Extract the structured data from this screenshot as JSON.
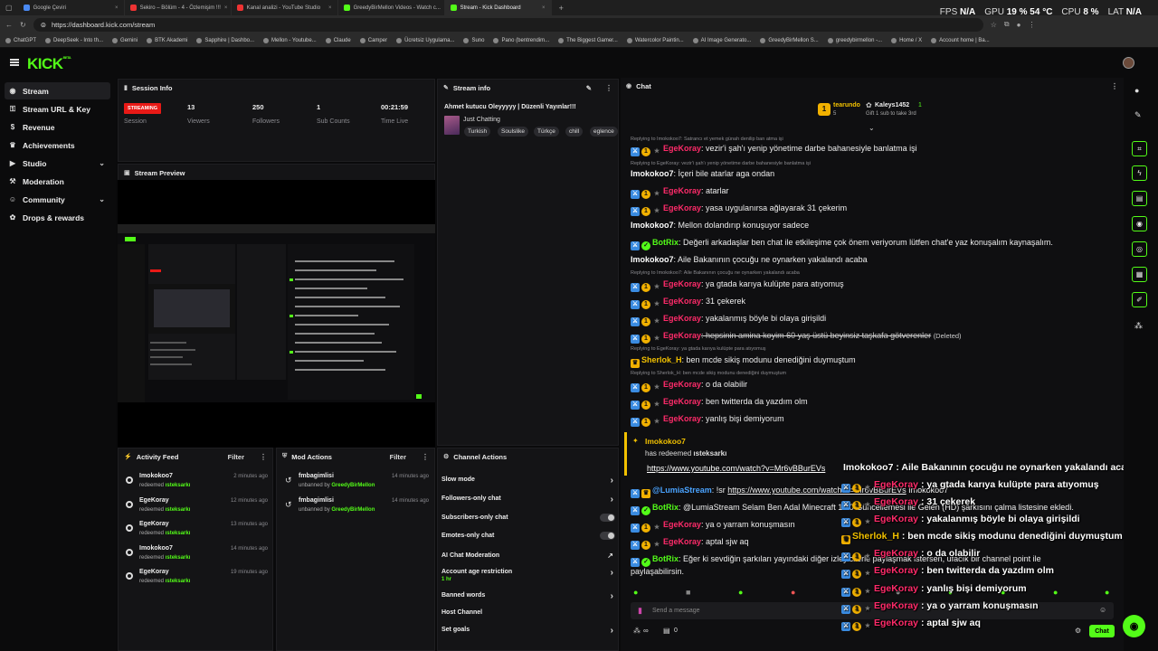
{
  "browser": {
    "tabs": [
      {
        "title": "Google Çeviri",
        "color": "#4a8af4"
      },
      {
        "title": "Sekiro – Bölüm - 4 - Özlemişim !!!",
        "color": "#e33"
      },
      {
        "title": "Kanal analizi - YouTube Studio",
        "color": "#e33"
      },
      {
        "title": "GreedyBirMellon Videos - Watch c...",
        "color": "#53fc18"
      },
      {
        "title": "Stream - Kick Dashboard",
        "color": "#53fc18"
      }
    ],
    "url": "https://dashboard.kick.com/stream",
    "stats": {
      "fps_label": "FPS",
      "fps": "N/A",
      "gpu_label": "GPU",
      "gpu": "19 % 54 °C",
      "cpu_label": "CPU",
      "cpu": "8 %",
      "lat_label": "LAT",
      "lat": "N/A"
    },
    "bookmarks": [
      "ChatGPT",
      "DeepSeek - Into th...",
      "Gemini",
      "BTK Akademi",
      "Sapphire | Dashbo...",
      "Mellon - Youtube...",
      "Claude",
      "Camper",
      "Ücretsiz Uygulama...",
      "Suno",
      "Pano (bentrendim...",
      "The Biggest Gamer...",
      "Watercolor Paintin...",
      "AI Image Generato...",
      "GreedyBirMellon S...",
      "greedybirmellon -...",
      "Home / X",
      "Account home | Ba..."
    ]
  },
  "brand": {
    "logo": "KICK",
    "logo_sup": "BETA",
    "accent": "#53fc18"
  },
  "sidebar": {
    "items": [
      {
        "label": "Stream",
        "icon": "radio-icon"
      },
      {
        "label": "Stream URL & Key",
        "icon": "key-icon"
      },
      {
        "label": "Revenue",
        "icon": "dollar-icon"
      },
      {
        "label": "Achievements",
        "icon": "trophy-icon"
      },
      {
        "label": "Studio",
        "icon": "video-icon"
      },
      {
        "label": "Moderation",
        "icon": "hammer-icon"
      },
      {
        "label": "Community",
        "icon": "people-icon"
      },
      {
        "label": "Drops & rewards",
        "icon": "gift-icon"
      }
    ]
  },
  "session": {
    "title": "Session Info",
    "status": "STREAMING",
    "status_label": "Session",
    "viewers": "13",
    "viewers_label": "Viewers",
    "followers": "250",
    "followers_label": "Followers",
    "subs": "1",
    "subs_label": "Sub Counts",
    "time": "00:21:59",
    "time_label": "Time Live"
  },
  "stream_info": {
    "title": "Stream info",
    "stream_title": "Ahmet kutucu Oleyyyyy | Düzenli Yayınlar!!!",
    "category": "Just Chatting",
    "tags": [
      "Turkish",
      "Soulslike",
      "Türkçe",
      "chill",
      "eglence"
    ]
  },
  "preview": {
    "title": "Stream Preview"
  },
  "activity": {
    "title": "Activity Feed",
    "filter": "Filter",
    "items": [
      {
        "user": "Imokokoo7",
        "action": "redeemed",
        "reward": "ısteksarkı",
        "time": "2 minutes ago"
      },
      {
        "user": "EgeKoray",
        "action": "redeemed",
        "reward": "ısteksarkı",
        "time": "12 minutes ago"
      },
      {
        "user": "EgeKoray",
        "action": "redeemed",
        "reward": "ısteksarkı",
        "time": "13 minutes ago"
      },
      {
        "user": "Imokokoo7",
        "action": "redeemed",
        "reward": "ısteksarkı",
        "time": "14 minutes ago"
      },
      {
        "user": "EgeKoray",
        "action": "redeemed",
        "reward": "ısteksarkı",
        "time": "19 minutes ago"
      }
    ]
  },
  "mod_actions": {
    "title": "Mod Actions",
    "filter": "Filter",
    "items": [
      {
        "user": "fmbagimlisi",
        "action": "unbanned by",
        "by": "GreedyBirMellon",
        "time": "14 minutes ago"
      },
      {
        "user": "fmbagimlisi",
        "action": "unbanned by",
        "by": "GreedyBirMellon",
        "time": "14 minutes ago"
      }
    ]
  },
  "channel_actions": {
    "title": "Channel Actions",
    "items": [
      {
        "label": "Slow mode",
        "kind": "chevron"
      },
      {
        "label": "Followers-only chat",
        "kind": "chevron"
      },
      {
        "label": "Subscribers-only chat",
        "kind": "toggle"
      },
      {
        "label": "Emotes-only chat",
        "kind": "toggle"
      },
      {
        "label": "AI Chat Moderation",
        "kind": "external"
      },
      {
        "label": "Account age restriction",
        "kind": "chevron",
        "sub": "1 hr"
      },
      {
        "label": "Banned words",
        "kind": "chevron"
      },
      {
        "label": "Host Channel",
        "kind": "none"
      },
      {
        "label": "Set goals",
        "kind": "chevron"
      }
    ]
  },
  "chat": {
    "title": "Chat",
    "pinned": {
      "user1": "tearundo",
      "count1": "5",
      "user2": "Kaleys1452",
      "count2": "1",
      "gift": "Gift 1 sub to take 3rd"
    },
    "messages": [
      {
        "reply": "Replying to Imokokoo7: Satrancı et yemek günah denilip ban atma işi"
      },
      {
        "badges": [
          "blue",
          "gold",
          "grey"
        ],
        "user": "EgeKoray",
        "ucolor": "red",
        "text": ": vezir'i şah'ı yenip yönetime darbe bahanesiyle banlatma işi"
      },
      {
        "reply": "Replying to EgeKoray: vezir'i şah'ı yenip yönetime darbe bahanesiyle banlatma işi"
      },
      {
        "badges": [],
        "user": "Imokokoo7",
        "ucolor": "white",
        "text": ": İçeri bile atarlar aga ondan"
      },
      {
        "badges": [
          "blue",
          "gold",
          "grey"
        ],
        "user": "EgeKoray",
        "ucolor": "red",
        "text": ": atarlar"
      },
      {
        "badges": [
          "blue",
          "gold",
          "grey"
        ],
        "user": "EgeKoray",
        "ucolor": "red",
        "text": ": yasa uygulanırsa ağlayarak 31 çekerim"
      },
      {
        "badges": [],
        "user": "Imokokoo7",
        "ucolor": "white",
        "text": ": Mellon dolandırıp konuşuyor sadece"
      },
      {
        "badges": [
          "blue",
          "green"
        ],
        "user": "BotRix",
        "ucolor": "green",
        "text": ": Değerli arkadaşlar ben chat ile etkileşime çok önem veriyorum lütfen chat'e yaz konuşalım kaynaşalım."
      },
      {
        "badges": [],
        "user": "Imokokoo7",
        "ucolor": "white",
        "text": ": Aile Bakanının çocuğu ne oynarken yakalandı acaba"
      },
      {
        "reply": "Replying to Imokokoo7: Aile Bakanının çocuğu ne oynarken yakalandı acaba"
      },
      {
        "badges": [
          "blue",
          "gold",
          "grey"
        ],
        "user": "EgeKoray",
        "ucolor": "red",
        "text": ": ya gtada karıya kulüpte para atıyomuş"
      },
      {
        "badges": [
          "blue",
          "gold",
          "grey"
        ],
        "user": "EgeKoray",
        "ucolor": "red",
        "text": ": 31 çekerek"
      },
      {
        "badges": [
          "blue",
          "gold",
          "grey"
        ],
        "user": "EgeKoray",
        "ucolor": "red",
        "text": ": yakalanmış böyle bi olaya girişildi"
      },
      {
        "badges": [
          "blue",
          "gold",
          "grey"
        ],
        "user": "EgeKoray",
        "ucolor": "red",
        "text": ": hepsinin amina koyim 60 yaş üstü beyinsiz taşkafa götverenler",
        "deleted": "(Deleted)"
      },
      {
        "reply": "Replying to EgeKoray: ya gtada karıya kulüpte para atıyomuş"
      },
      {
        "badges": [
          "crown"
        ],
        "user": "Sherlok_H",
        "ucolor": "orange",
        "text": ": ben mcde sikiş modunu denediğini duymuştum"
      },
      {
        "reply": "Replying to Sherlok_H: ben mcde sikiş modunu denediğini duymuştum"
      },
      {
        "badges": [
          "blue",
          "gold",
          "grey"
        ],
        "user": "EgeKoray",
        "ucolor": "red",
        "text": ": o da olabilir"
      },
      {
        "badges": [
          "blue",
          "gold",
          "grey"
        ],
        "user": "EgeKoray",
        "ucolor": "red",
        "text": ": ben twitterda da yazdım olm"
      },
      {
        "badges": [
          "blue",
          "gold",
          "grey"
        ],
        "user": "EgeKoray",
        "ucolor": "red",
        "text": ": yanlış bişi demiyorum"
      }
    ],
    "redeem": {
      "user": "Imokokoo7",
      "line": "has redeemed",
      "reward": "ısteksarkı",
      "link": "https://www.youtube.com/watch?v=Mr6vBBurEVs"
    },
    "after": [
      {
        "badges": [
          "blue",
          "crown"
        ],
        "user": "@LumiaStream",
        "ucolor": "blue",
        "text": ": !sr ",
        "link": "https://www.youtube.com/watch?v=Mr6vBBurEVs",
        "tail": " Imokokoo7"
      },
      {
        "badges": [
          "blue",
          "green"
        ],
        "user": "BotRix",
        "ucolor": "green",
        "text": ": @LumiaStream Selam Ben Adal Minecraft 1.20 Güncellemesi ile Gelen (HD) şarkısını çalma listesine ekledi."
      },
      {
        "badges": [
          "blue",
          "gold",
          "grey"
        ],
        "user": "EgeKoray",
        "ucolor": "red",
        "text": ": ya o yarram konuşmasın"
      },
      {
        "badges": [
          "blue",
          "gold",
          "grey"
        ],
        "user": "EgeKoray",
        "ucolor": "red",
        "text": ": aptal sjw aq"
      },
      {
        "badges": [
          "blue",
          "green"
        ],
        "user": "BotRix",
        "ucolor": "green",
        "text": ": Eğer ki sevdiğin şarkıları yayındaki diğer izleyicilerle paylaşmak istersen, ufacık bir channel point ile"
      },
      {
        "badges": [],
        "user": "",
        "ucolor": "white",
        "text": "paylaşabilirsin."
      }
    ],
    "overlay": [
      {
        "user": "Imokokoo7",
        "text": " : Aile Bakanının çocuğu ne oynarken yakalandı acaba",
        "ucolor": "white",
        "badges": false
      },
      {
        "user": "EgeKoray",
        "text": " : ya gtada karıya kulüpte para atıyomuş",
        "ucolor": "red",
        "badges": true
      },
      {
        "user": "EgeKoray",
        "text": " : 31 çekerek",
        "ucolor": "red",
        "badges": true
      },
      {
        "user": "EgeKoray",
        "text": " : yakalanmış böyle bi olaya girişildi",
        "ucolor": "red",
        "badges": true
      },
      {
        "user": "Sherlok_H",
        "text": " : ben mcde sikiş modunu denediğini duymuştum",
        "ucolor": "orange",
        "badges": "crown"
      },
      {
        "user": "EgeKoray",
        "text": " : o da olabilir",
        "ucolor": "red",
        "badges": true
      },
      {
        "user": "EgeKoray",
        "text": " : ben twitterda da yazdım olm",
        "ucolor": "red",
        "badges": true
      },
      {
        "user": "EgeKoray",
        "text": " : yanlış bişi demiyorum",
        "ucolor": "red",
        "badges": true
      },
      {
        "user": "EgeKoray",
        "text": " : ya o yarram konuşmasın",
        "ucolor": "red",
        "badges": true
      },
      {
        "user": "EgeKoray",
        "text": " : aptal sjw aq",
        "ucolor": "red",
        "badges": true
      }
    ],
    "input_placeholder": "Send a message",
    "points": "∞",
    "counter": "0",
    "send_label": "Chat"
  }
}
